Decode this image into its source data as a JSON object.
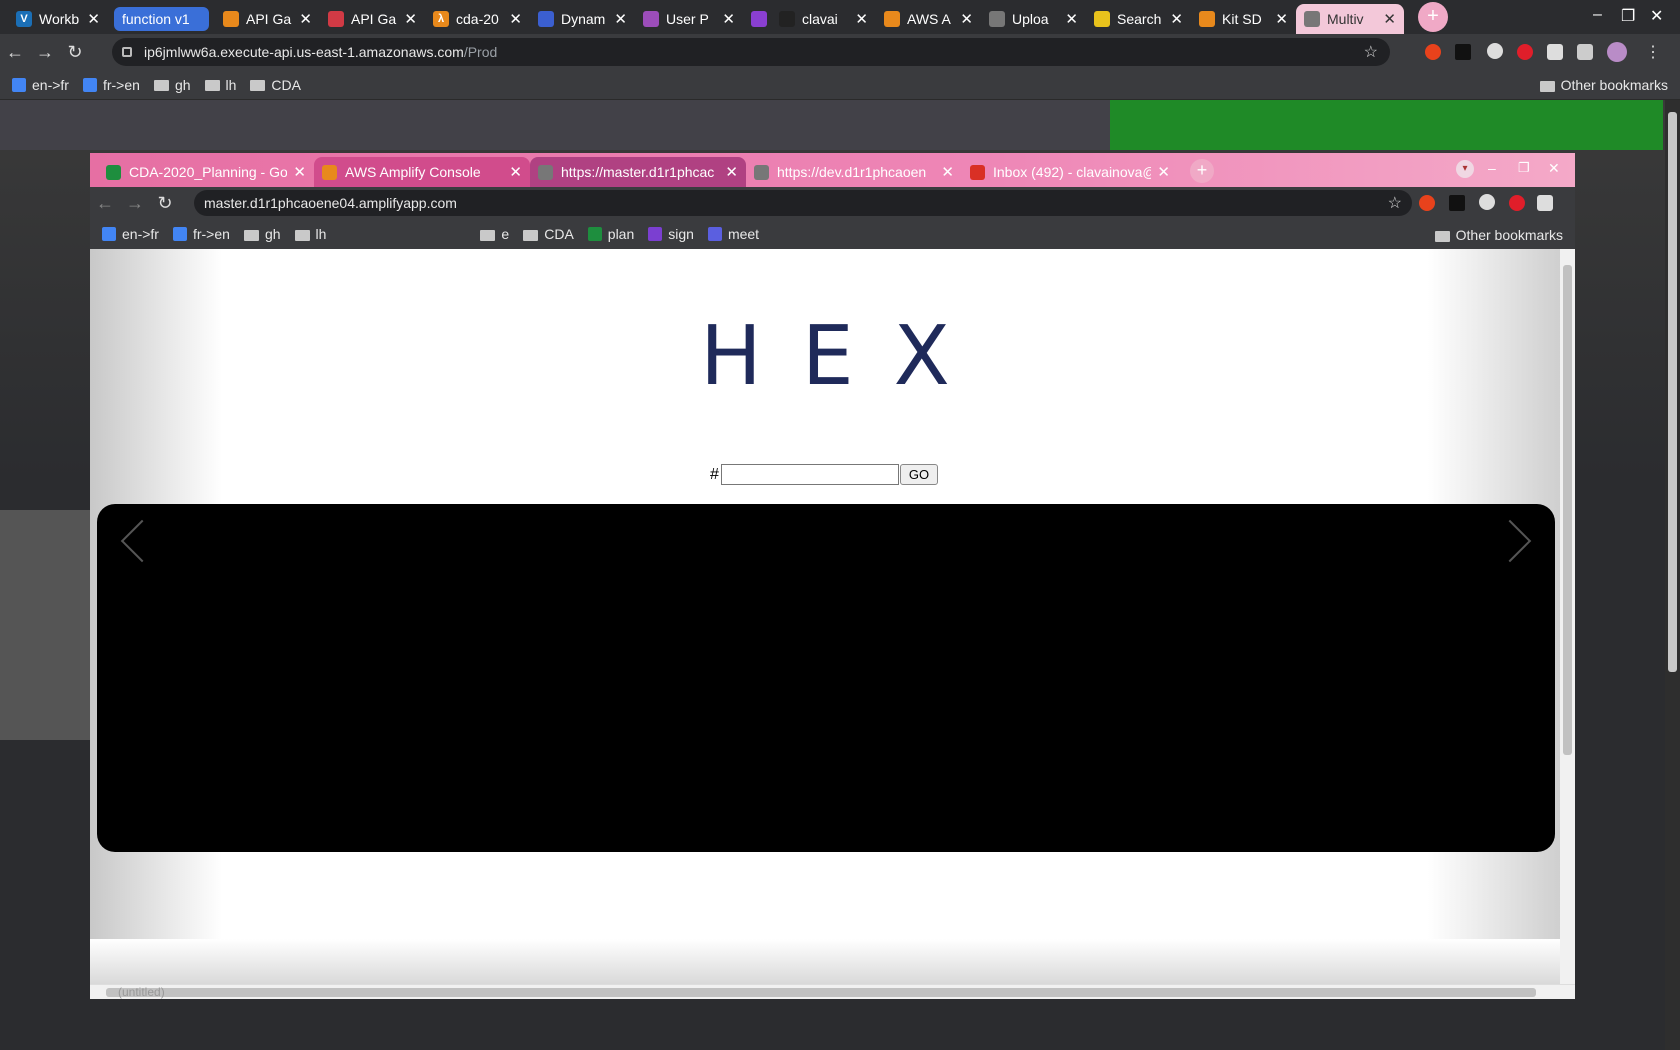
{
  "outer_tabs": [
    {
      "label": "Workb",
      "icon": "V",
      "color": "#1b6fb6"
    },
    {
      "label": "function v1",
      "group": true
    },
    {
      "label": "API Ga",
      "icon": "",
      "color": "#e8891c"
    },
    {
      "label": "API Ga",
      "icon": "",
      "color": "#d13a45"
    },
    {
      "label": "cda-20",
      "icon": "λ",
      "color": "#e8891c"
    },
    {
      "label": "Dynam",
      "icon": "",
      "color": "#3b5fd0"
    },
    {
      "label": "User P",
      "icon": "",
      "color": "#9c4dba"
    },
    {
      "label": "",
      "icon": "",
      "color": "#8a3fd1"
    },
    {
      "label": "clavai",
      "icon": "",
      "color": "#222"
    },
    {
      "label": "AWS A",
      "icon": "",
      "color": "#e8891c"
    },
    {
      "label": "Uploa",
      "icon": "",
      "color": "#777"
    },
    {
      "label": "Search",
      "icon": "",
      "color": "#e8c21c"
    },
    {
      "label": "Kit SD",
      "icon": "",
      "color": "#e8891c"
    },
    {
      "label": "Multiv",
      "icon": "",
      "color": "#777",
      "active": true
    }
  ],
  "outer_url": {
    "host": "ip6jmlww6a.execute-api.us-east-1.amazonaws.com",
    "path": "/Prod"
  },
  "outer_bookmarks": [
    "en->fr",
    "fr->en",
    "gh",
    "lh",
    "CDA"
  ],
  "other_bookmarks": "Other bookmarks",
  "inner_tabs": [
    {
      "label": "CDA-2020_Planning - Goo",
      "color": "#1e8e3e"
    },
    {
      "label": "AWS Amplify Console",
      "color": "#e8891c",
      "active": true
    },
    {
      "label": "https://master.d1r1phcac",
      "color": "#777",
      "dark": true
    },
    {
      "label": "https://dev.d1r1phcaoen",
      "color": "#777"
    },
    {
      "label": "Inbox (492) - clavainova@",
      "color": "#d93025"
    }
  ],
  "inner_url": "master.d1r1phcaoene04.amplifyapp.com",
  "inner_bookmarks": [
    "en->fr",
    "fr->en",
    "gh",
    "lh",
    "e",
    "CDA",
    "plan",
    "sign",
    "meet"
  ],
  "page": {
    "title": "HEX",
    "hash_label": "#",
    "go_label": "GO",
    "input_value": ""
  },
  "untitled": "(untitled)"
}
